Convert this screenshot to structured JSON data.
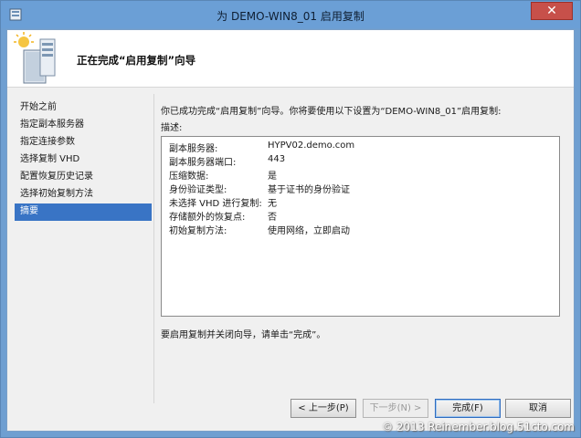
{
  "window": {
    "title": "为 DEMO-WIN8_01 启用复制",
    "close_glyph": "✕"
  },
  "header": {
    "title": "正在完成“启用复制”向导"
  },
  "nav": {
    "items": [
      {
        "label": "开始之前"
      },
      {
        "label": "指定副本服务器"
      },
      {
        "label": "指定连接参数"
      },
      {
        "label": "选择复制 VHD"
      },
      {
        "label": "配置恢复历史记录"
      },
      {
        "label": "选择初始复制方法"
      },
      {
        "label": "摘要"
      }
    ],
    "active_index": 6
  },
  "content": {
    "intro": "你已成功完成“启用复制”向导。你将要使用以下设置为“DEMO-WIN8_01”启用复制:",
    "description_label": "描述:",
    "summary": [
      {
        "key": "副本服务器:",
        "value": "HYPV02.demo.com"
      },
      {
        "key": "副本服务器端口:",
        "value": "443"
      },
      {
        "key": "压缩数据:",
        "value": "是"
      },
      {
        "key": "身份验证类型:",
        "value": "基于证书的身份验证"
      },
      {
        "key": "未选择 VHD 进行复制:",
        "value": "无"
      },
      {
        "key": "存储额外的恢复点:",
        "value": "否"
      },
      {
        "key": "初始复制方法:",
        "value": "使用网络，立即启动"
      }
    ],
    "footer_note": "要启用复制并关闭向导，请单击“完成”。"
  },
  "buttons": {
    "prev": "< 上一步(P)",
    "next": "下一步(N) >",
    "finish": "完成(F)",
    "cancel": "取消"
  },
  "watermark": "© 2013 Reinember.blog.51cto.com",
  "colors": {
    "titlebar": "#6b9fd6",
    "active_nav": "#3974c5",
    "close_button": "#c7504a"
  }
}
